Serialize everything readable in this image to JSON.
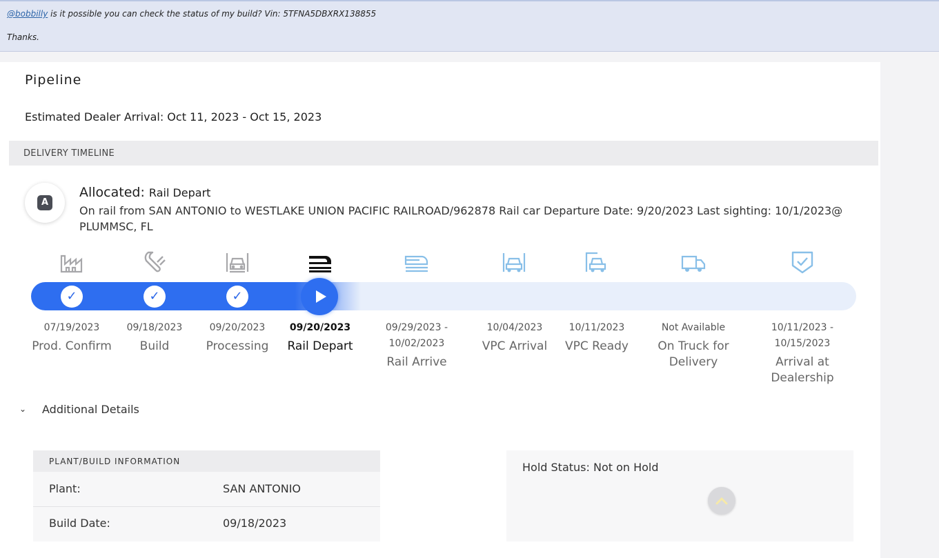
{
  "message": {
    "mention": "@bobbilly",
    "text": " is it possible you can check the status of my build? Vin: 5TFNA5DBXRX138855",
    "signoff": "Thanks."
  },
  "pipeline": {
    "title": "Pipeline",
    "eta": "Estimated Dealer Arrival: Oct 11, 2023 - Oct 15, 2023",
    "section_title": "DELIVERY TIMELINE",
    "avatar_letter": "A",
    "status_label": "Allocated:",
    "status_value": "Rail Depart",
    "status_desc": "On rail from SAN ANTONIO to WESTLAKE UNION PACIFIC RAILROAD/962878 Rail car Departure Date: 9/20/2023 Last sighting: 10/1/2023@ PLUMMSC, FL"
  },
  "stages": [
    {
      "date": "07/19/2023",
      "label": "Prod. Confirm",
      "icon": "factory-icon",
      "state": "done"
    },
    {
      "date": "09/18/2023",
      "label": "Build",
      "icon": "wrench-icon",
      "state": "done"
    },
    {
      "date": "09/20/2023",
      "label": "Processing",
      "icon": "car-garage-icon",
      "state": "done"
    },
    {
      "date": "09/20/2023",
      "label": "Rail Depart",
      "icon": "train-icon",
      "state": "current"
    },
    {
      "date": "09/29/2023 - 10/02/2023",
      "label": "Rail Arrive",
      "icon": "train-icon",
      "state": "pending"
    },
    {
      "date": "10/04/2023",
      "label": "VPC Arrival",
      "icon": "car-garage-icon",
      "state": "pending"
    },
    {
      "date": "10/11/2023",
      "label": "VPC Ready",
      "icon": "car-ready-icon",
      "state": "pending"
    },
    {
      "date": "Not Available",
      "label": "On Truck for Delivery",
      "icon": "truck-icon",
      "state": "pending"
    },
    {
      "date": "10/11/2023 - 10/15/2023",
      "label": "Arrival at Dealership",
      "icon": "shield-check-icon",
      "state": "pending"
    }
  ],
  "progress": {
    "completed_stages": 4,
    "total_stages": 9
  },
  "additional": {
    "toggle_label": "Additional Details",
    "plant_section_title": "PLANT/BUILD INFORMATION",
    "plant_label": "Plant:",
    "plant_value": "SAN ANTONIO",
    "build_date_label": "Build Date:",
    "build_date_value": "09/18/2023",
    "hold_status": "Hold Status: Not on Hold"
  },
  "colors": {
    "accent": "#2e6ef0",
    "done_icon": "#a7a7aa",
    "pending_icon": "#88bfe8",
    "message_bg": "#e1e6f3"
  }
}
